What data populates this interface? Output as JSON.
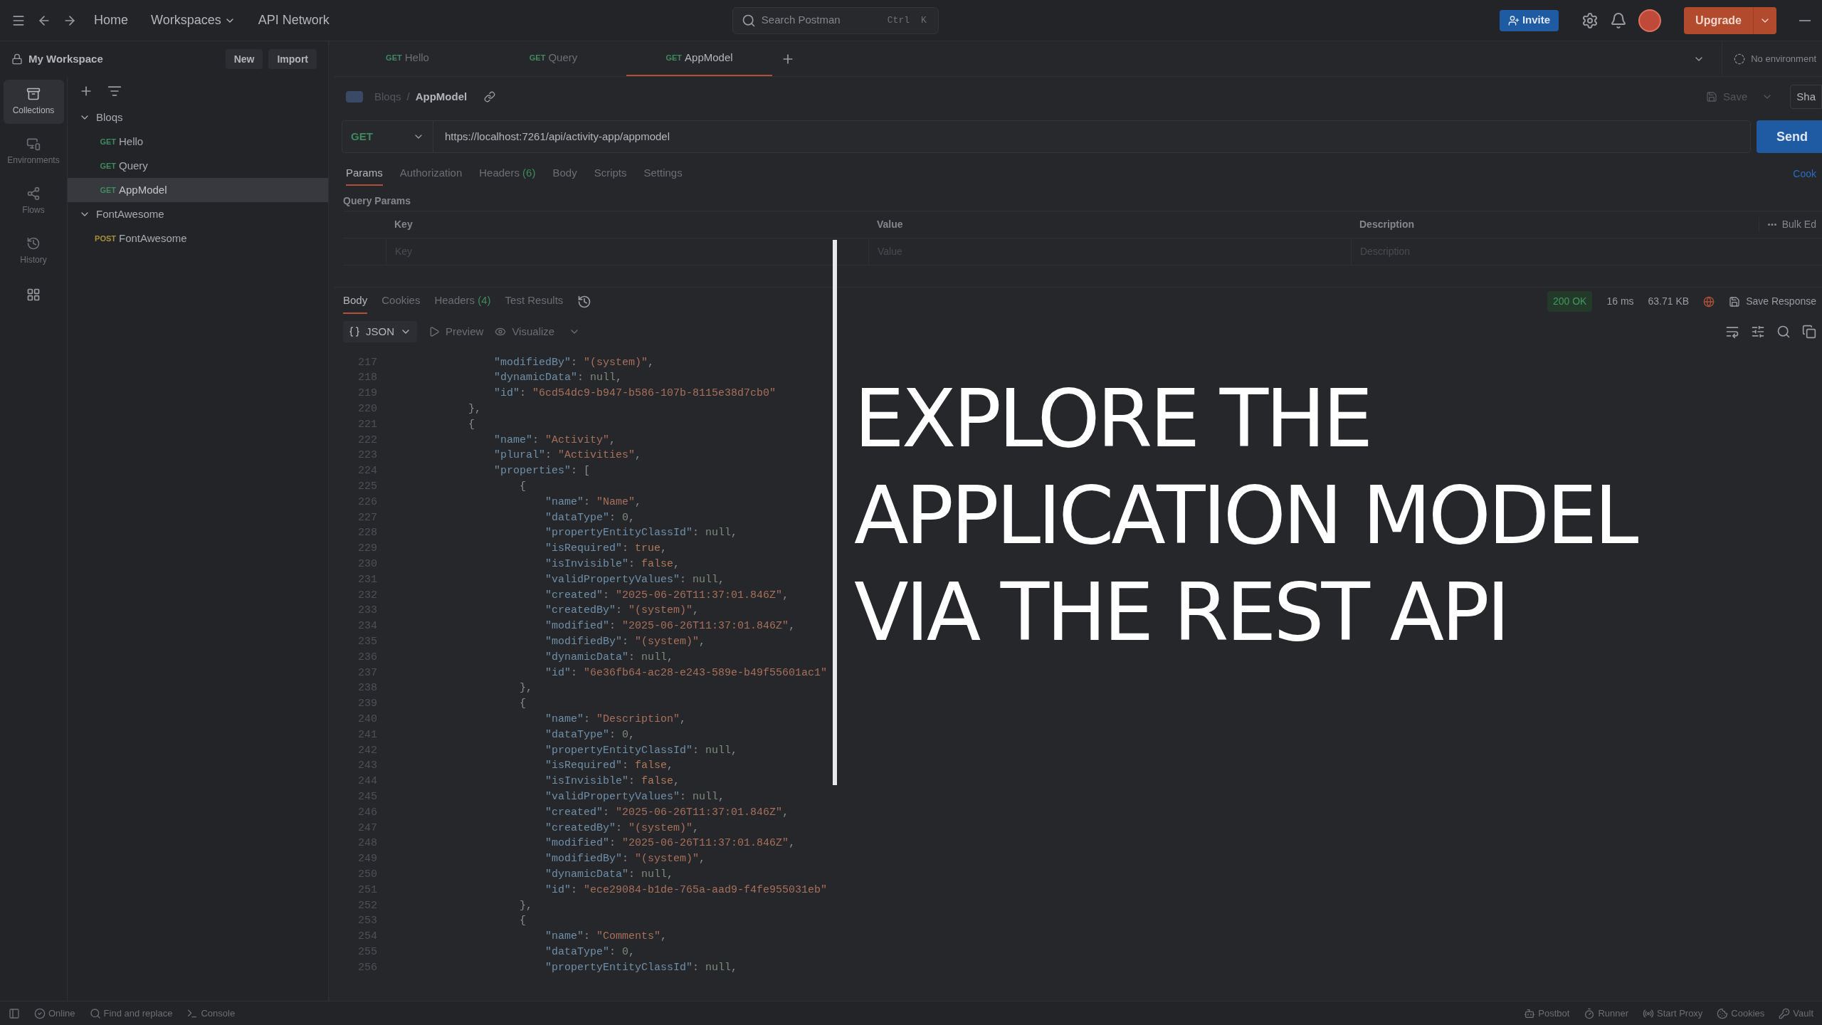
{
  "topbar": {
    "nav": [
      {
        "label": "Home",
        "dropdown": false
      },
      {
        "label": "Workspaces",
        "dropdown": true
      },
      {
        "label": "API Network",
        "dropdown": false
      }
    ],
    "search": {
      "placeholder": "Search Postman",
      "keys": [
        "Ctrl",
        "K"
      ]
    },
    "invite": "Invite",
    "upgrade": "Upgrade"
  },
  "workspace": {
    "title": "My Workspace",
    "buttons": [
      "New",
      "Import"
    ]
  },
  "tabs": [
    {
      "method": "GET",
      "color": "#3f8a5e",
      "name": "Hello",
      "selected": false
    },
    {
      "method": "GET",
      "color": "#3f8a5e",
      "name": "Query",
      "selected": false
    },
    {
      "method": "GET",
      "color": "#3f8a5e",
      "name": "AppModel",
      "selected": true
    }
  ],
  "environment": "No environment",
  "rail": [
    {
      "kind": "collections",
      "label": "Collections",
      "selected": true
    },
    {
      "kind": "environments",
      "label": "Environments",
      "selected": false
    },
    {
      "kind": "flows",
      "label": "Flows",
      "selected": false
    },
    {
      "kind": "history",
      "label": "History",
      "selected": false
    }
  ],
  "tree": [
    {
      "name": "Bloqs",
      "expanded": true,
      "children": [
        {
          "method": "GET",
          "color": "#3f8a5e",
          "name": "Hello",
          "selected": false
        },
        {
          "method": "GET",
          "color": "#3f8a5e",
          "name": "Query",
          "selected": false
        },
        {
          "method": "GET",
          "color": "#3f8a5e",
          "name": "AppModel",
          "selected": true
        }
      ]
    },
    {
      "name": "FontAwesome",
      "expanded": true,
      "children": [
        {
          "method": "POST",
          "color": "#a8903a",
          "name": "FontAwesome",
          "selected": false
        }
      ]
    }
  ],
  "breadcrumb": {
    "parent": "Bloqs",
    "separator": "/",
    "current": "AppModel"
  },
  "save": "Save",
  "share": "Sha",
  "request": {
    "method": "GET",
    "url": "https://localhost:7261/api/activity-app/appmodel",
    "send": "Send"
  },
  "request_tabs": [
    {
      "label": "Params",
      "selected": true
    },
    {
      "label": "Authorization",
      "selected": false
    },
    {
      "label": "Headers",
      "count": "(6)",
      "selected": false
    },
    {
      "label": "Body",
      "selected": false
    },
    {
      "label": "Scripts",
      "selected": false
    },
    {
      "label": "Settings",
      "selected": false
    }
  ],
  "cookies_link": "Cook",
  "query_params": {
    "title": "Query Params",
    "columns": [
      "Key",
      "Value",
      "Description"
    ],
    "bulk_edit": "Bulk Ed",
    "placeholders": [
      "Key",
      "Value",
      "Description"
    ]
  },
  "response_tabs": [
    {
      "label": "Body",
      "selected": true
    },
    {
      "label": "Cookies",
      "selected": false
    },
    {
      "label": "Headers",
      "count": "(4)",
      "selected": false
    },
    {
      "label": "Test Results",
      "selected": false
    }
  ],
  "response_meta": {
    "status": "200 OK",
    "time": "16 ms",
    "size": "63.71 KB",
    "save": "Save Response"
  },
  "format": {
    "type": "JSON",
    "preview": "Preview",
    "visualize": "Visualize"
  },
  "code": [
    {
      "n": "217",
      "parts": [
        {
          "kind": "key",
          "text": "                \"modifiedBy\""
        },
        {
          "kind": "p",
          "text": ": "
        },
        {
          "kind": "str",
          "text": "\"(system)\""
        },
        {
          "kind": "p",
          "text": ","
        }
      ]
    },
    {
      "n": "218",
      "parts": [
        {
          "kind": "key",
          "text": "                \"dynamicData\""
        },
        {
          "kind": "p",
          "text": ": "
        },
        {
          "kind": "lit",
          "text": "null"
        },
        {
          "kind": "p",
          "text": ","
        }
      ]
    },
    {
      "n": "219",
      "parts": [
        {
          "kind": "key",
          "text": "                \"id\""
        },
        {
          "kind": "p",
          "text": ": "
        },
        {
          "kind": "str",
          "text": "\"6cd54dc9-b947-b586-107b-8115e38d7cb0\""
        }
      ]
    },
    {
      "n": "220",
      "parts": [
        {
          "kind": "p",
          "text": "            },"
        }
      ]
    },
    {
      "n": "221",
      "parts": [
        {
          "kind": "p",
          "text": "            {"
        }
      ]
    },
    {
      "n": "222",
      "parts": [
        {
          "kind": "key",
          "text": "                \"name\""
        },
        {
          "kind": "p",
          "text": ": "
        },
        {
          "kind": "str",
          "text": "\"Activity\""
        },
        {
          "kind": "p",
          "text": ","
        }
      ]
    },
    {
      "n": "223",
      "parts": [
        {
          "kind": "key",
          "text": "                \"plural\""
        },
        {
          "kind": "p",
          "text": ": "
        },
        {
          "kind": "str",
          "text": "\"Activities\""
        },
        {
          "kind": "p",
          "text": ","
        }
      ]
    },
    {
      "n": "224",
      "parts": [
        {
          "kind": "key",
          "text": "                \"properties\""
        },
        {
          "kind": "p",
          "text": ": ["
        }
      ]
    },
    {
      "n": "225",
      "parts": [
        {
          "kind": "p",
          "text": "                    {"
        }
      ]
    },
    {
      "n": "226",
      "parts": [
        {
          "kind": "key",
          "text": "                        \"name\""
        },
        {
          "kind": "p",
          "text": ": "
        },
        {
          "kind": "str",
          "text": "\"Name\""
        },
        {
          "kind": "p",
          "text": ","
        }
      ]
    },
    {
      "n": "227",
      "parts": [
        {
          "kind": "key",
          "text": "                        \"dataType\""
        },
        {
          "kind": "p",
          "text": ": "
        },
        {
          "kind": "lit",
          "text": "0"
        },
        {
          "kind": "p",
          "text": ","
        }
      ]
    },
    {
      "n": "228",
      "parts": [
        {
          "kind": "key",
          "text": "                        \"propertyEntityClassId\""
        },
        {
          "kind": "p",
          "text": ": "
        },
        {
          "kind": "lit",
          "text": "null"
        },
        {
          "kind": "p",
          "text": ","
        }
      ]
    },
    {
      "n": "229",
      "parts": [
        {
          "kind": "key",
          "text": "                        \"isRequired\""
        },
        {
          "kind": "p",
          "text": ": "
        },
        {
          "kind": "bool",
          "text": "true"
        },
        {
          "kind": "p",
          "text": ","
        }
      ]
    },
    {
      "n": "230",
      "parts": [
        {
          "kind": "key",
          "text": "                        \"isInvisible\""
        },
        {
          "kind": "p",
          "text": ": "
        },
        {
          "kind": "bool",
          "text": "false"
        },
        {
          "kind": "p",
          "text": ","
        }
      ]
    },
    {
      "n": "231",
      "parts": [
        {
          "kind": "key",
          "text": "                        \"validPropertyValues\""
        },
        {
          "kind": "p",
          "text": ": "
        },
        {
          "kind": "lit",
          "text": "null"
        },
        {
          "kind": "p",
          "text": ","
        }
      ]
    },
    {
      "n": "232",
      "parts": [
        {
          "kind": "key",
          "text": "                        \"created\""
        },
        {
          "kind": "p",
          "text": ": "
        },
        {
          "kind": "str",
          "text": "\"2025-06-26T11:37:01.846Z\""
        },
        {
          "kind": "p",
          "text": ","
        }
      ]
    },
    {
      "n": "233",
      "parts": [
        {
          "kind": "key",
          "text": "                        \"createdBy\""
        },
        {
          "kind": "p",
          "text": ": "
        },
        {
          "kind": "str",
          "text": "\"(system)\""
        },
        {
          "kind": "p",
          "text": ","
        }
      ]
    },
    {
      "n": "234",
      "parts": [
        {
          "kind": "key",
          "text": "                        \"modified\""
        },
        {
          "kind": "p",
          "text": ": "
        },
        {
          "kind": "str",
          "text": "\"2025-06-26T11:37:01.846Z\""
        },
        {
          "kind": "p",
          "text": ","
        }
      ]
    },
    {
      "n": "235",
      "parts": [
        {
          "kind": "key",
          "text": "                        \"modifiedBy\""
        },
        {
          "kind": "p",
          "text": ": "
        },
        {
          "kind": "str",
          "text": "\"(system)\""
        },
        {
          "kind": "p",
          "text": ","
        }
      ]
    },
    {
      "n": "236",
      "parts": [
        {
          "kind": "key",
          "text": "                        \"dynamicData\""
        },
        {
          "kind": "p",
          "text": ": "
        },
        {
          "kind": "lit",
          "text": "null"
        },
        {
          "kind": "p",
          "text": ","
        }
      ]
    },
    {
      "n": "237",
      "parts": [
        {
          "kind": "key",
          "text": "                        \"id\""
        },
        {
          "kind": "p",
          "text": ": "
        },
        {
          "kind": "str",
          "text": "\"6e36fb64-ac28-e243-589e-b49f55601ac1\""
        }
      ]
    },
    {
      "n": "238",
      "parts": [
        {
          "kind": "p",
          "text": "                    },"
        }
      ]
    },
    {
      "n": "239",
      "parts": [
        {
          "kind": "p",
          "text": "                    {"
        }
      ]
    },
    {
      "n": "240",
      "parts": [
        {
          "kind": "key",
          "text": "                        \"name\""
        },
        {
          "kind": "p",
          "text": ": "
        },
        {
          "kind": "str",
          "text": "\"Description\""
        },
        {
          "kind": "p",
          "text": ","
        }
      ]
    },
    {
      "n": "241",
      "parts": [
        {
          "kind": "key",
          "text": "                        \"dataType\""
        },
        {
          "kind": "p",
          "text": ": "
        },
        {
          "kind": "lit",
          "text": "0"
        },
        {
          "kind": "p",
          "text": ","
        }
      ]
    },
    {
      "n": "242",
      "parts": [
        {
          "kind": "key",
          "text": "                        \"propertyEntityClassId\""
        },
        {
          "kind": "p",
          "text": ": "
        },
        {
          "kind": "lit",
          "text": "null"
        },
        {
          "kind": "p",
          "text": ","
        }
      ]
    },
    {
      "n": "243",
      "parts": [
        {
          "kind": "key",
          "text": "                        \"isRequired\""
        },
        {
          "kind": "p",
          "text": ": "
        },
        {
          "kind": "bool",
          "text": "false"
        },
        {
          "kind": "p",
          "text": ","
        }
      ]
    },
    {
      "n": "244",
      "parts": [
        {
          "kind": "key",
          "text": "                        \"isInvisible\""
        },
        {
          "kind": "p",
          "text": ": "
        },
        {
          "kind": "bool",
          "text": "false"
        },
        {
          "kind": "p",
          "text": ","
        }
      ]
    },
    {
      "n": "245",
      "parts": [
        {
          "kind": "key",
          "text": "                        \"validPropertyValues\""
        },
        {
          "kind": "p",
          "text": ": "
        },
        {
          "kind": "lit",
          "text": "null"
        },
        {
          "kind": "p",
          "text": ","
        }
      ]
    },
    {
      "n": "246",
      "parts": [
        {
          "kind": "key",
          "text": "                        \"created\""
        },
        {
          "kind": "p",
          "text": ": "
        },
        {
          "kind": "str",
          "text": "\"2025-06-26T11:37:01.846Z\""
        },
        {
          "kind": "p",
          "text": ","
        }
      ]
    },
    {
      "n": "247",
      "parts": [
        {
          "kind": "key",
          "text": "                        \"createdBy\""
        },
        {
          "kind": "p",
          "text": ": "
        },
        {
          "kind": "str",
          "text": "\"(system)\""
        },
        {
          "kind": "p",
          "text": ","
        }
      ]
    },
    {
      "n": "248",
      "parts": [
        {
          "kind": "key",
          "text": "                        \"modified\""
        },
        {
          "kind": "p",
          "text": ": "
        },
        {
          "kind": "str",
          "text": "\"2025-06-26T11:37:01.846Z\""
        },
        {
          "kind": "p",
          "text": ","
        }
      ]
    },
    {
      "n": "249",
      "parts": [
        {
          "kind": "key",
          "text": "                        \"modifiedBy\""
        },
        {
          "kind": "p",
          "text": ": "
        },
        {
          "kind": "str",
          "text": "\"(system)\""
        },
        {
          "kind": "p",
          "text": ","
        }
      ]
    },
    {
      "n": "250",
      "parts": [
        {
          "kind": "key",
          "text": "                        \"dynamicData\""
        },
        {
          "kind": "p",
          "text": ": "
        },
        {
          "kind": "lit",
          "text": "null"
        },
        {
          "kind": "p",
          "text": ","
        }
      ]
    },
    {
      "n": "251",
      "parts": [
        {
          "kind": "key",
          "text": "                        \"id\""
        },
        {
          "kind": "p",
          "text": ": "
        },
        {
          "kind": "str",
          "text": "\"ece29084-b1de-765a-aad9-f4fe955031eb\""
        }
      ]
    },
    {
      "n": "252",
      "parts": [
        {
          "kind": "p",
          "text": "                    },"
        }
      ]
    },
    {
      "n": "253",
      "parts": [
        {
          "kind": "p",
          "text": "                    {"
        }
      ]
    },
    {
      "n": "254",
      "parts": [
        {
          "kind": "key",
          "text": "                        \"name\""
        },
        {
          "kind": "p",
          "text": ": "
        },
        {
          "kind": "str",
          "text": "\"Comments\""
        },
        {
          "kind": "p",
          "text": ","
        }
      ]
    },
    {
      "n": "255",
      "parts": [
        {
          "kind": "key",
          "text": "                        \"dataType\""
        },
        {
          "kind": "p",
          "text": ": "
        },
        {
          "kind": "lit",
          "text": "0"
        },
        {
          "kind": "p",
          "text": ","
        }
      ]
    },
    {
      "n": "256",
      "parts": [
        {
          "kind": "key",
          "text": "                        \"propertyEntityClassId\""
        },
        {
          "kind": "p",
          "text": ": "
        },
        {
          "kind": "lit",
          "text": "null"
        },
        {
          "kind": "p",
          "text": ","
        }
      ]
    }
  ],
  "overlay": {
    "lines": [
      "EXPLORE THE",
      "APPLICATION MODEL",
      "VIA THE REST API"
    ]
  },
  "status_bar": {
    "left": [
      {
        "kind": "online",
        "label": "Online"
      },
      {
        "kind": "find",
        "label": "Find and replace"
      },
      {
        "kind": "console",
        "label": "Console"
      }
    ],
    "right": [
      {
        "kind": "postbot",
        "label": "Postbot"
      },
      {
        "kind": "runner",
        "label": "Runner"
      },
      {
        "kind": "proxy",
        "label": "Start Proxy"
      },
      {
        "kind": "cookies",
        "label": "Cookies"
      },
      {
        "kind": "vault",
        "label": "Vault"
      }
    ]
  }
}
